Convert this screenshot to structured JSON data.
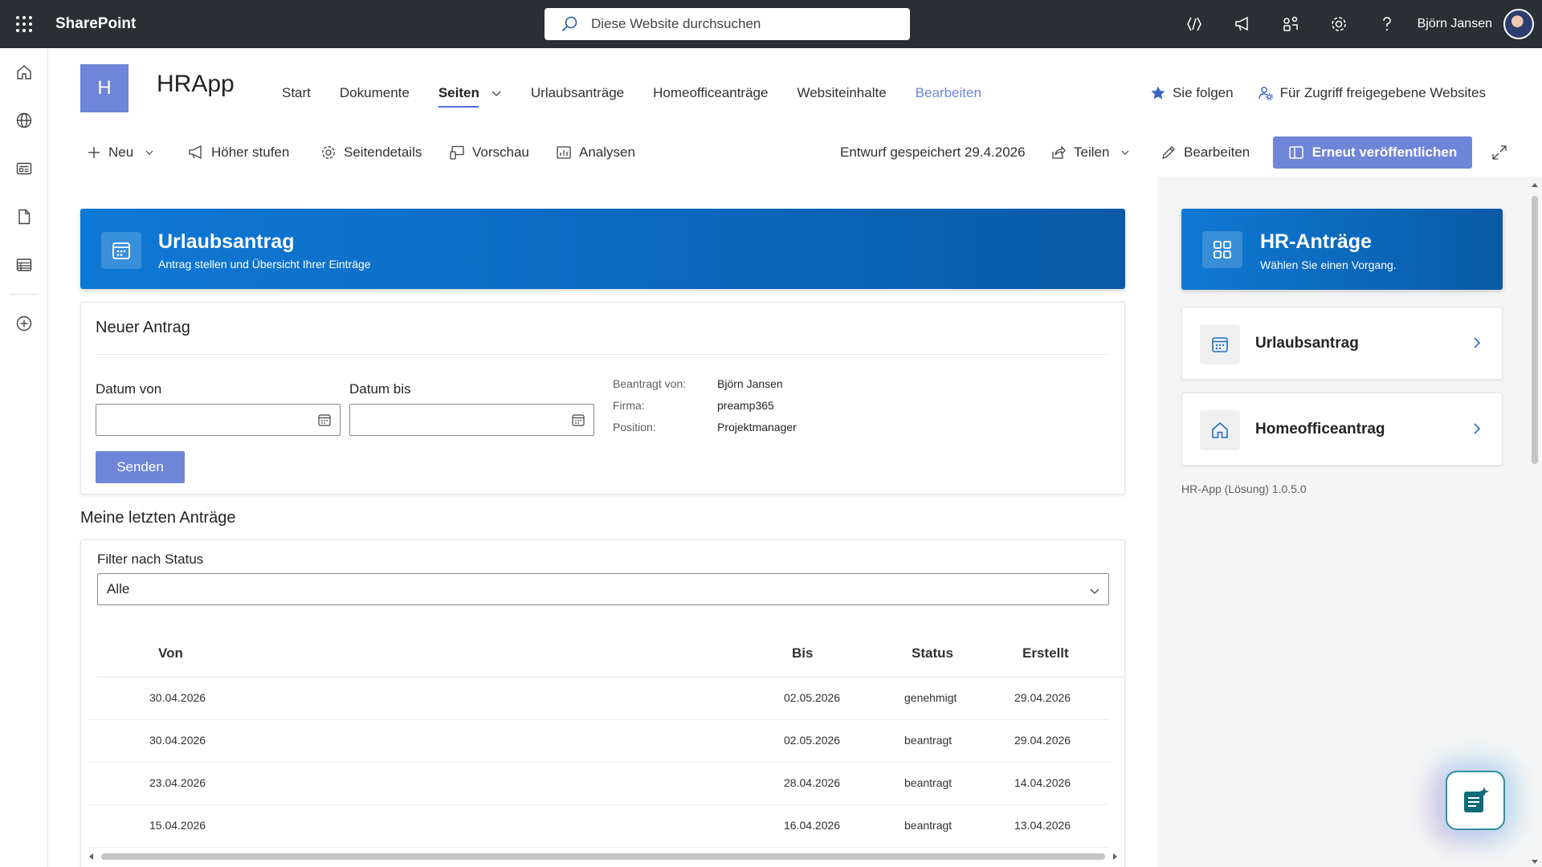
{
  "suite": {
    "brand": "SharePoint",
    "search_placeholder": "Diese Website durchsuchen",
    "user_name": "Björn Jansen"
  },
  "site": {
    "logo_letter": "H",
    "title": "HRApp",
    "nav": [
      {
        "label": "Start"
      },
      {
        "label": "Dokumente"
      },
      {
        "label": "Seiten"
      },
      {
        "label": "Urlaubsanträge"
      },
      {
        "label": "Homeofficeanträge"
      },
      {
        "label": "Websiteinhalte"
      },
      {
        "label": "Bearbeiten"
      }
    ],
    "follow_label": "Sie folgen",
    "shared_label": "Für Zugriff freigegebene Websites"
  },
  "commands": {
    "new": "Neu",
    "promote": "Höher stufen",
    "page_details": "Seitendetails",
    "preview": "Vorschau",
    "analytics": "Analysen",
    "draft_status": "Entwurf gespeichert 29.4.2026",
    "share": "Teilen",
    "edit": "Bearbeiten",
    "republish": "Erneut veröffentlichen"
  },
  "banner": {
    "title": "Urlaubsantrag",
    "subtitle": "Antrag stellen und Übersicht Ihrer Einträge"
  },
  "form": {
    "title": "Neuer Antrag",
    "date_from_label": "Datum von",
    "date_to_label": "Datum bis",
    "requested_by_label": "Beantragt von:",
    "requested_by_value": "Björn Jansen",
    "company_label": "Firma:",
    "company_value": "preamp365",
    "position_label": "Position:",
    "position_value": "Projektmanager",
    "send_label": "Senden"
  },
  "requests": {
    "section_title": "Meine letzten Anträge",
    "filter_label": "Filter nach Status",
    "filter_value": "Alle",
    "columns": {
      "from": "Von",
      "to": "Bis",
      "status": "Status",
      "created": "Erstellt"
    },
    "rows": [
      {
        "from": "30.04.2026",
        "to": "02.05.2026",
        "status": "genehmigt",
        "created": "29.04.2026"
      },
      {
        "from": "30.04.2026",
        "to": "02.05.2026",
        "status": "beantragt",
        "created": "29.04.2026"
      },
      {
        "from": "23.04.2026",
        "to": "28.04.2026",
        "status": "beantragt",
        "created": "14.04.2026"
      },
      {
        "from": "15.04.2026",
        "to": "16.04.2026",
        "status": "beantragt",
        "created": "13.04.2026"
      }
    ]
  },
  "side": {
    "banner_title": "HR-Anträge",
    "banner_subtitle": "Wählen Sie einen Vorgang.",
    "tiles": [
      {
        "label": "Urlaubsantrag",
        "icon": "calendar-icon"
      },
      {
        "label": "Homeofficeantrag",
        "icon": "home-icon"
      }
    ],
    "version": "HR-App (Lösung) 1.0.5.0"
  },
  "colors": {
    "suite_bar": "#2b2f33",
    "accent": "#6f85d8",
    "banner_blue": "#0c67bf"
  }
}
